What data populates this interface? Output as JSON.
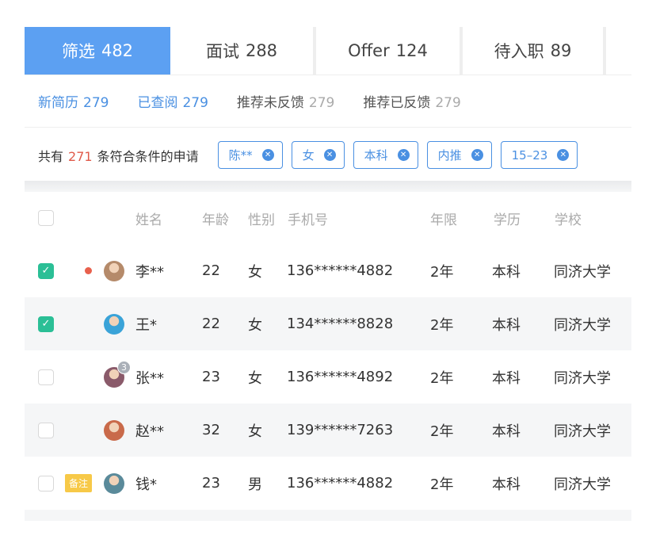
{
  "tabs": [
    {
      "label": "筛选",
      "count": "482",
      "active": true
    },
    {
      "label": "面试",
      "count": "288",
      "active": false
    },
    {
      "label": "Offer",
      "count": "124",
      "active": false
    },
    {
      "label": "待入职",
      "count": "89",
      "active": false
    }
  ],
  "subtabs": [
    {
      "label": "新简历",
      "count": "279",
      "highlight": true
    },
    {
      "label": "已查阅",
      "count": "279",
      "highlight": true
    },
    {
      "label": "推荐未反馈",
      "count": "279",
      "highlight": false
    },
    {
      "label": "推荐已反馈",
      "count": "279",
      "highlight": false
    }
  ],
  "filter": {
    "prefix": "共有",
    "count": "271",
    "suffix": "条符合条件的申请",
    "chips": [
      "陈**",
      "女",
      "本科",
      "内推",
      "15–23"
    ]
  },
  "table": {
    "headers": {
      "name": "姓名",
      "age": "年龄",
      "gender": "性别",
      "phone": "手机号",
      "years": "年限",
      "education": "学历",
      "school": "学校"
    },
    "rows": [
      {
        "checked": true,
        "dot": true,
        "note": "",
        "badge": "",
        "avatar_color": "#b58a6a",
        "name": "李**",
        "age": "22",
        "gender": "女",
        "phone": "136******4882",
        "years": "2年",
        "education": "本科",
        "school": "同济大学"
      },
      {
        "checked": true,
        "dot": false,
        "note": "",
        "badge": "",
        "avatar_color": "#3aa3d8",
        "name": "王*",
        "age": "22",
        "gender": "女",
        "phone": "134******8828",
        "years": "2年",
        "education": "本科",
        "school": "同济大学"
      },
      {
        "checked": false,
        "dot": false,
        "note": "",
        "badge": "3",
        "avatar_color": "#8a5a6a",
        "name": "张**",
        "age": "23",
        "gender": "女",
        "phone": "136******4892",
        "years": "2年",
        "education": "本科",
        "school": "同济大学"
      },
      {
        "checked": false,
        "dot": false,
        "note": "",
        "badge": "",
        "avatar_color": "#c96a4a",
        "name": "赵**",
        "age": "32",
        "gender": "女",
        "phone": "139******7263",
        "years": "2年",
        "education": "本科",
        "school": "同济大学"
      },
      {
        "checked": false,
        "dot": false,
        "note": "备注",
        "badge": "",
        "avatar_color": "#5a8a9a",
        "name": "钱*",
        "age": "23",
        "gender": "男",
        "phone": "136******4882",
        "years": "2年",
        "education": "本科",
        "school": "同济大学"
      }
    ]
  },
  "colors": {
    "accent": "#5ca0f2",
    "link": "#4a90e2",
    "check": "#2bbf96",
    "alert": "#e05a4a",
    "note": "#f7c948"
  }
}
